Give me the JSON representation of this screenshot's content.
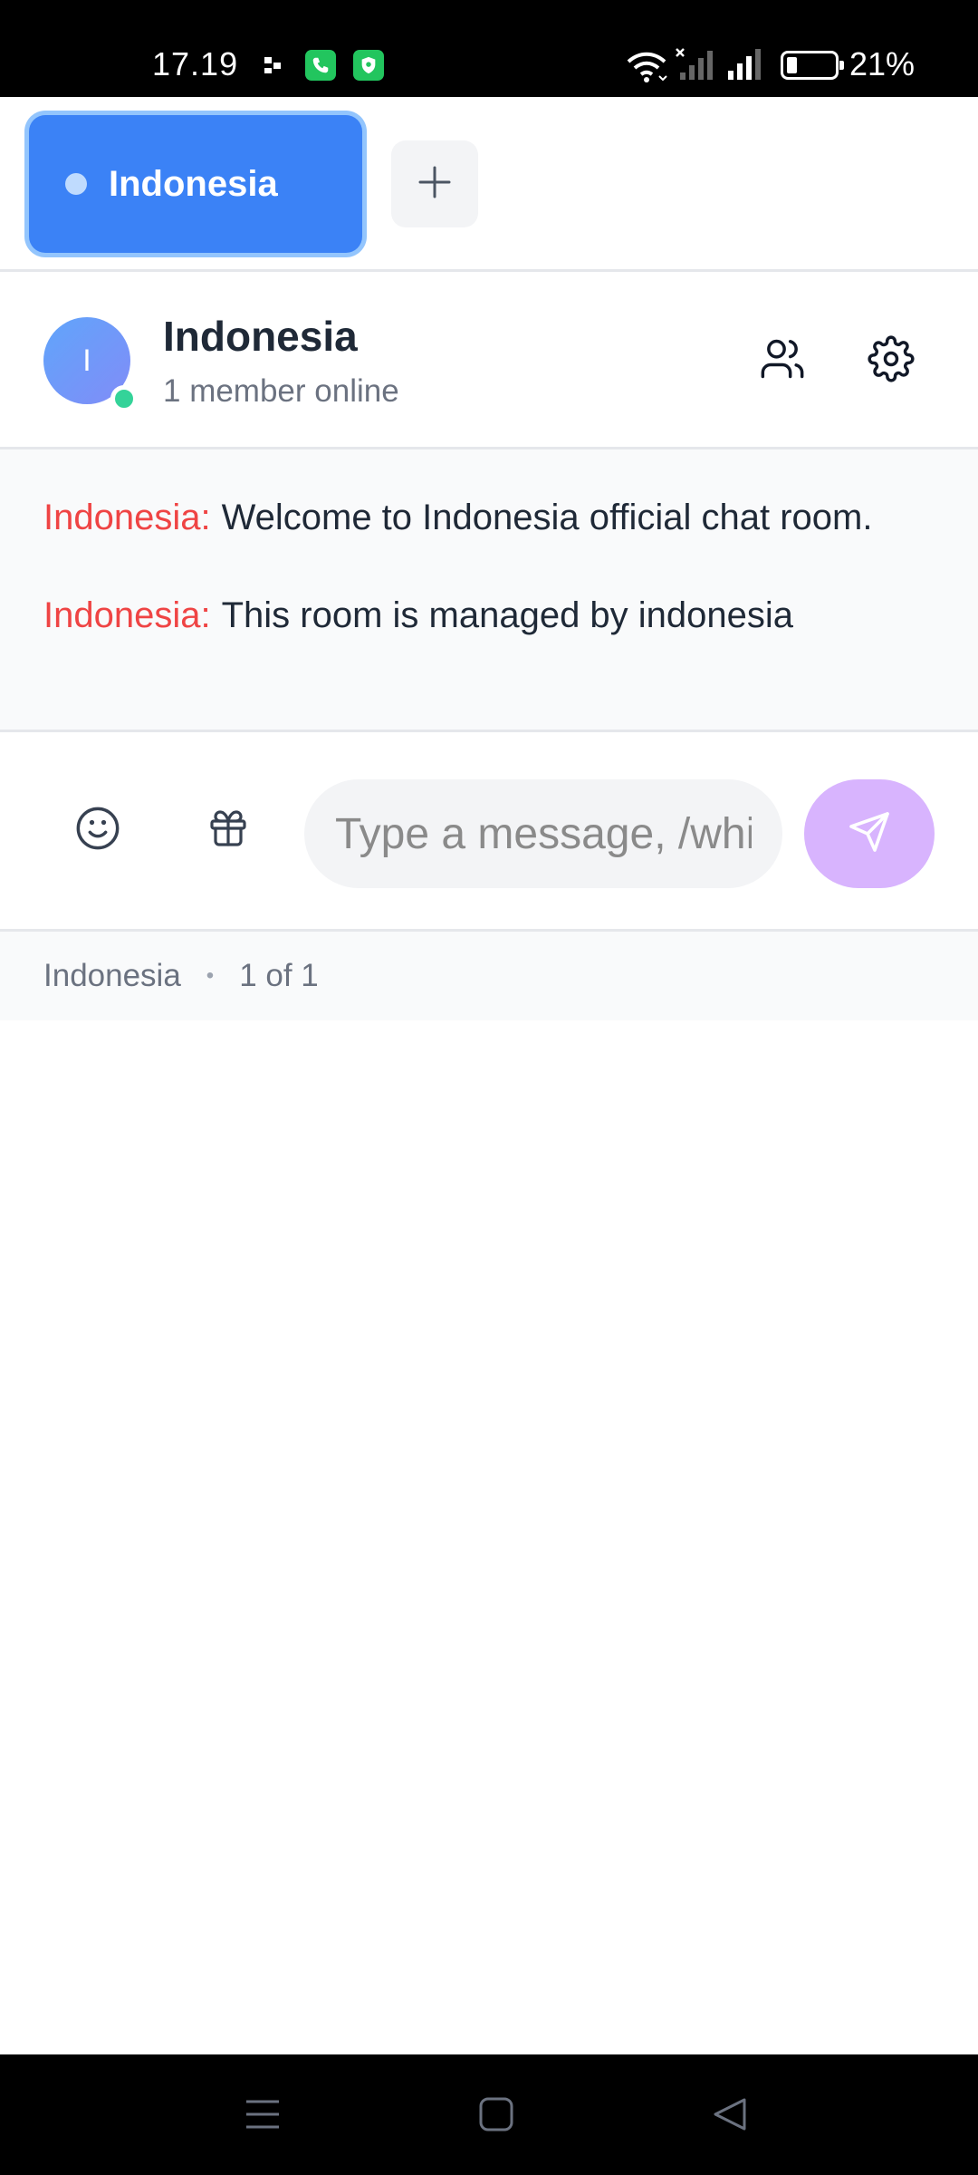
{
  "status_bar": {
    "time": "17.19",
    "battery_percent": "21%",
    "battery_level": 0.21
  },
  "tabs": {
    "active_tab_label": "Indonesia",
    "add_icon": "plus-icon"
  },
  "room": {
    "avatar_letter": "I",
    "name": "Indonesia",
    "online_text": "1 member online",
    "icons": [
      "members-icon",
      "gear-icon"
    ]
  },
  "messages": [
    {
      "sender": "Indonesia:",
      "text": "Welcome to Indonesia official chat room."
    },
    {
      "sender": "Indonesia:",
      "text": "This room is managed by indonesia"
    }
  ],
  "composer": {
    "placeholder": "Type a message, /whisper",
    "icons": [
      "emoji-icon",
      "gift-icon",
      "send-icon"
    ]
  },
  "footer": {
    "room": "Indonesia",
    "separator": "•",
    "page": "1 of 1"
  },
  "colors": {
    "accent": "#3b82f6",
    "sender": "#ef4444",
    "send_button": "#d8b4fe",
    "online": "#34d399"
  }
}
